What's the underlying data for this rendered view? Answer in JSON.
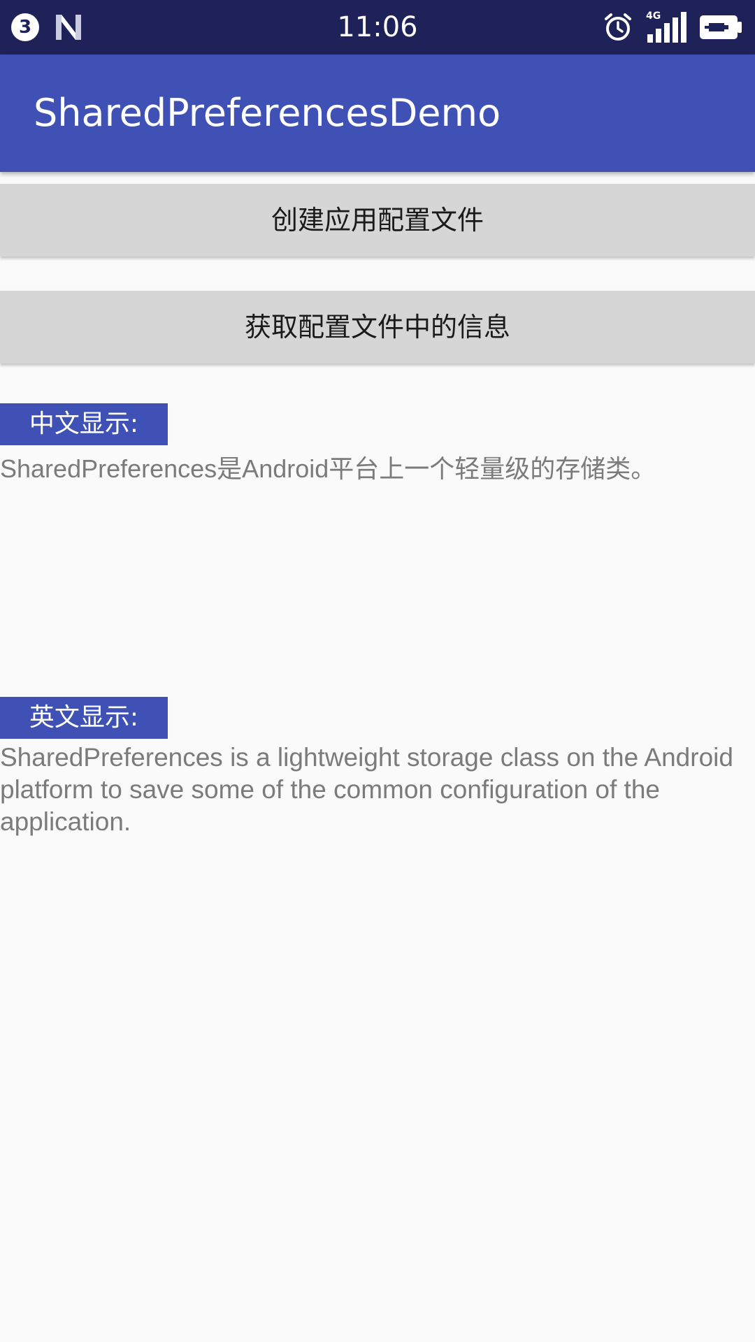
{
  "status_bar": {
    "notification_count": "3",
    "time": "11:06",
    "network_type": "4G",
    "icons": [
      "notification-count-icon",
      "android-n-icon",
      "alarm-icon",
      "signal-icon",
      "battery-icon"
    ],
    "background_color": "#1f2258"
  },
  "app_bar": {
    "title": "SharedPreferencesDemo",
    "background_color": "#3f51b5"
  },
  "buttons": {
    "create_config": "创建应用配置文件",
    "get_config": "获取配置文件中的信息"
  },
  "sections": {
    "chinese": {
      "label": "中文显示:",
      "text": "SharedPreferences是Android平台上一个轻量级的存储类。"
    },
    "english": {
      "label": "英文显示:",
      "text": "SharedPreferences is a lightweight storage class on the Android platform to save some of the common configuration of the application."
    }
  },
  "colors": {
    "accent": "#3f51b5",
    "button_bg": "#d6d6d6",
    "body_text": "#7b7b7b",
    "page_bg": "#fafafa"
  }
}
